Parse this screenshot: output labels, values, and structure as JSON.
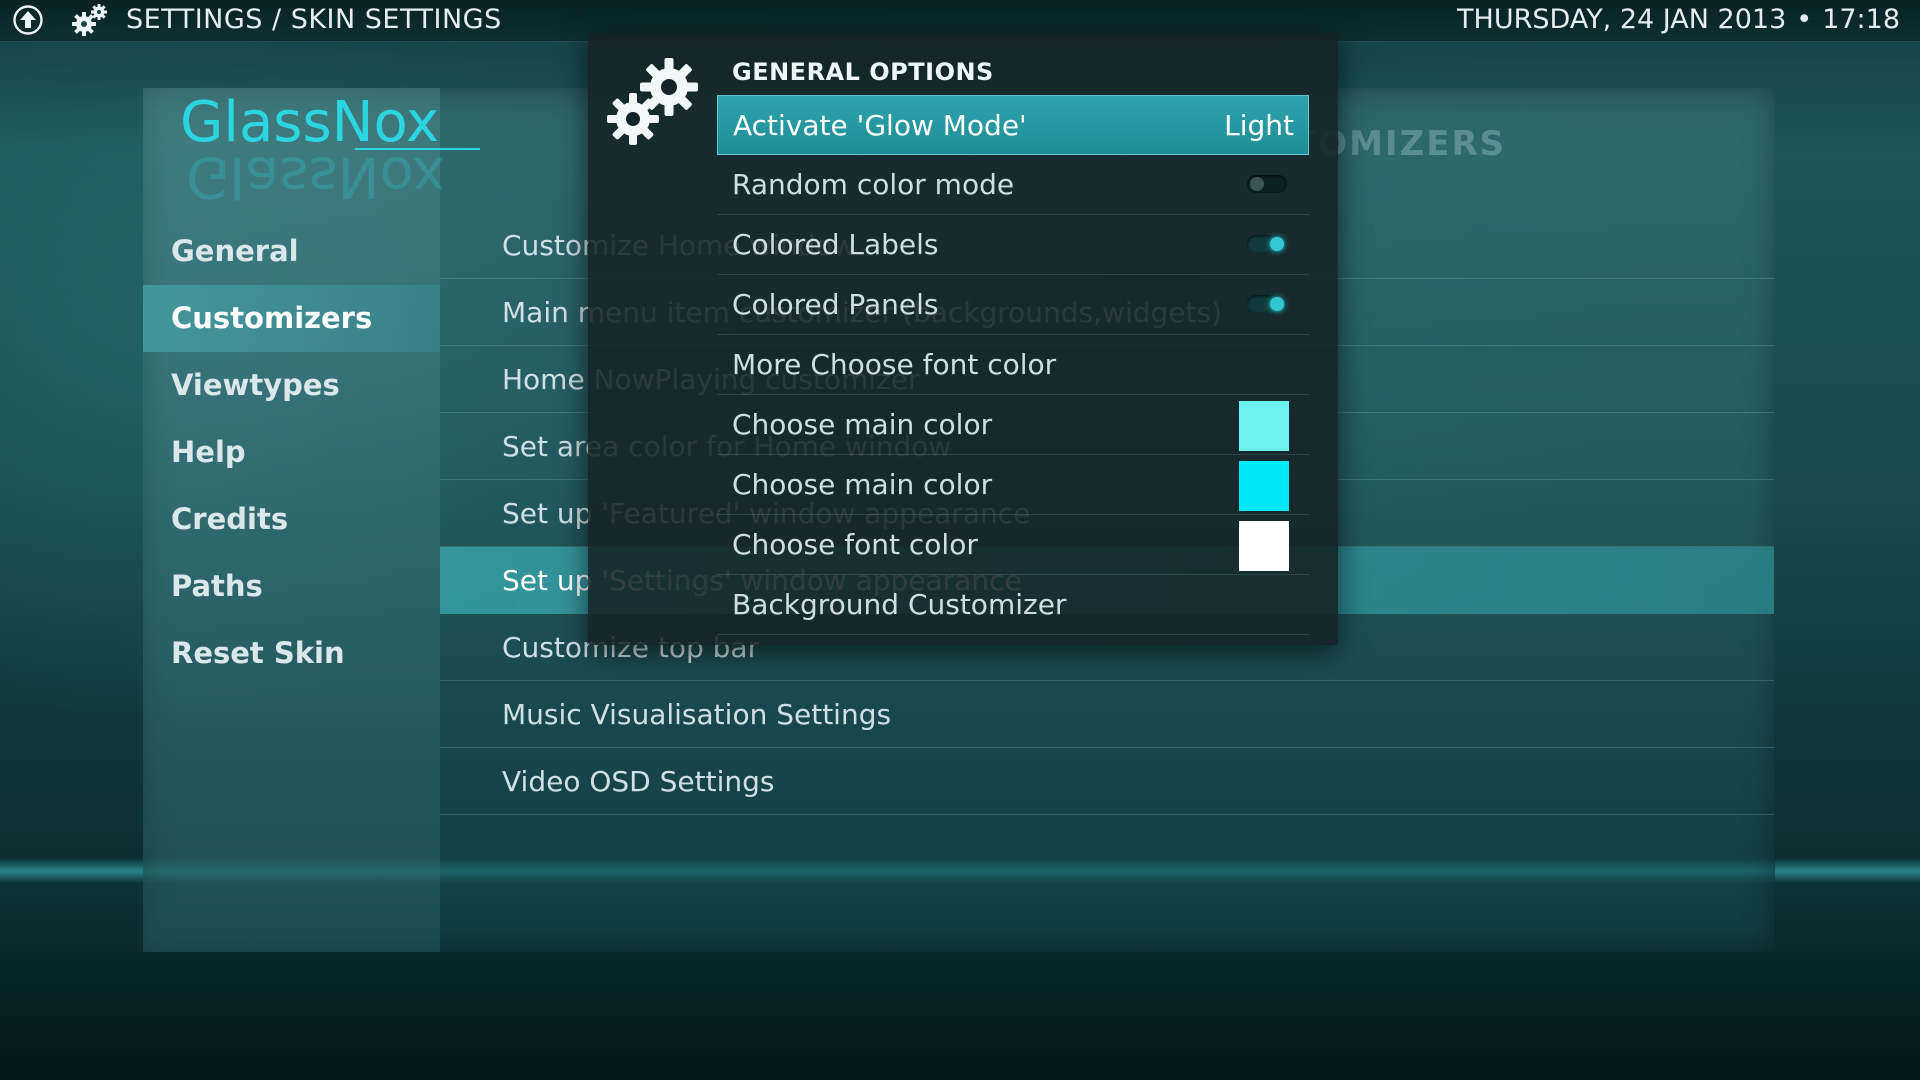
{
  "topbar": {
    "breadcrumb": "SETTINGS / SKIN SETTINGS",
    "date": "THURSDAY, 24 JAN 2013",
    "separator": "•",
    "time": "17:18"
  },
  "logo": {
    "text": "GlassNox"
  },
  "background_title": "SKIN SETTINGS - CUSTOMIZERS",
  "sidebar": {
    "items": [
      {
        "label": "General"
      },
      {
        "label": "Customizers"
      },
      {
        "label": "Viewtypes"
      },
      {
        "label": "Help"
      },
      {
        "label": "Credits"
      },
      {
        "label": "Paths"
      },
      {
        "label": "Reset Skin"
      }
    ],
    "active_index": 1
  },
  "content": {
    "rows": [
      {
        "label": "Customize Home window"
      },
      {
        "label": "Main menu item customizer (backgrounds,widgets)"
      },
      {
        "label": "Home NowPlaying customizer"
      },
      {
        "label": "Set area color for Home window"
      },
      {
        "label": "Set up 'Featured' window appearance"
      },
      {
        "label": "Set up 'Settings' window appearance"
      },
      {
        "label": "Customize top bar"
      },
      {
        "label": "Music Visualisation Settings"
      },
      {
        "label": "Video OSD Settings"
      }
    ],
    "active_index": 5
  },
  "dialog": {
    "title": "GENERAL OPTIONS",
    "options": [
      {
        "label": "Activate 'Glow Mode'",
        "value": "Light"
      },
      {
        "label": "Random color mode",
        "toggle": "off"
      },
      {
        "label": "Colored Labels",
        "toggle": "on"
      },
      {
        "label": "Colored Panels",
        "toggle": "on"
      },
      {
        "label": "More Choose font color"
      },
      {
        "label": "Choose main color",
        "swatch": "#6ef0ee"
      },
      {
        "label": "Choose main color",
        "swatch": "#00e8f8"
      },
      {
        "label": "Choose font color",
        "swatch": "#ffffff"
      },
      {
        "label": "Background Customizer"
      }
    ]
  },
  "colors": {
    "accent": "#2cd6e0",
    "highlight": "#2ea4ad"
  },
  "icons": {
    "topbar_home": "up-arrow-circle-icon",
    "topbar_settings": "gear-icon",
    "dialog": "gears-icon"
  }
}
